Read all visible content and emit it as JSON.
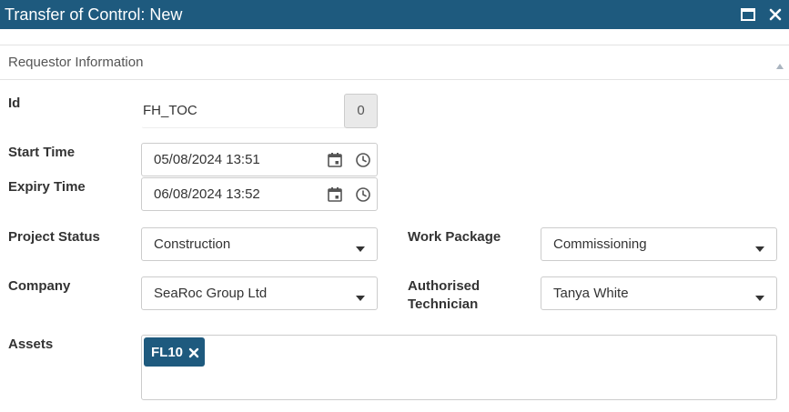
{
  "window": {
    "title": "Transfer of Control: New"
  },
  "section": {
    "title": "Requestor Information"
  },
  "fields": {
    "id": {
      "label": "Id",
      "value": "FH_TOC",
      "counter": "0"
    },
    "start_time": {
      "label": "Start Time",
      "value": "05/08/2024 13:51"
    },
    "expiry_time": {
      "label": "Expiry Time",
      "value": "06/08/2024 13:52"
    },
    "project_status": {
      "label": "Project Status",
      "value": "Construction"
    },
    "work_package": {
      "label": "Work Package",
      "value": "Commissioning"
    },
    "company": {
      "label": "Company",
      "value": "SeaRoc Group Ltd"
    },
    "authorised_technician": {
      "label_line1": "Authorised",
      "label_line2": "Technician",
      "value": "Tanya White"
    },
    "assets": {
      "label": "Assets",
      "tags": [
        "FL10"
      ]
    }
  },
  "colors": {
    "titlebar": "#1e5a7e",
    "tag": "#1e5a7e"
  },
  "icons": {
    "maximize": "maximize-icon",
    "close": "close-icon",
    "calendar": "calendar-icon",
    "clock": "clock-icon",
    "dropdown": "chevron-down-icon",
    "collapse": "chevron-up-icon",
    "tag_remove": "close-icon"
  }
}
